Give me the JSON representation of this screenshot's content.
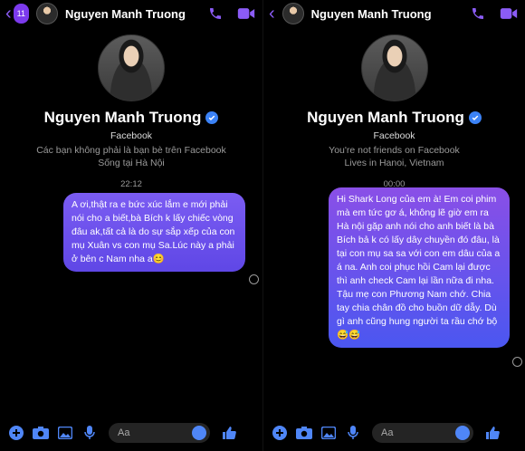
{
  "left": {
    "header": {
      "back_badge": "11",
      "name": "Nguyen Manh Truong"
    },
    "profile": {
      "name": "Nguyen Manh Truong",
      "subtitle": "Facebook",
      "friend_status": "Các bạn không phải là bạn bè trên Facebook",
      "location": "Sống tại Hà Nội"
    },
    "time": "22:12",
    "message": "A ơi,thật ra e bức xúc lắm e mới phải nói cho a biết,bà Bích k lấy chiếc vòng đâu ak,tất cả là do sự sắp xếp của con mụ Xuân vs con mụ Sa.Lúc này a phải ở bên c Nam nha a😊",
    "composer": {
      "placeholder": "Aa"
    }
  },
  "right": {
    "header": {
      "name": "Nguyen Manh Truong"
    },
    "profile": {
      "name": "Nguyen Manh Truong",
      "subtitle": "Facebook",
      "friend_status": "You're not friends on Facebook",
      "location": "Lives in Hanoi, Vietnam"
    },
    "time": "00:00",
    "message": "Hi Shark Long của em à! Em coi phim mà em tức gơ á, không lẽ giờ em ra Hà nội gặp anh nói cho anh biết là bà Bích bả k có lấy dây chuyền đó đâu, là tại con mụ sa sa với con em dâu của a á na. Anh coi phục hồi Cam lại được thì anh check Cam lại lần nữa đi nha. Tậu mẹ con Phương Nam chớ. Chia tay chia chân đồ cho buồn dữ dẫy. Dù gì anh cũng hung người ta rầu chớ bộ 😅😅",
    "composer": {
      "placeholder": "Aa"
    }
  },
  "colors": {
    "accent": "#8b5cf6",
    "bubble_top": "#7b5cf2",
    "bubble_bottom": "#4b57f0",
    "verified": "#3b82f6"
  }
}
